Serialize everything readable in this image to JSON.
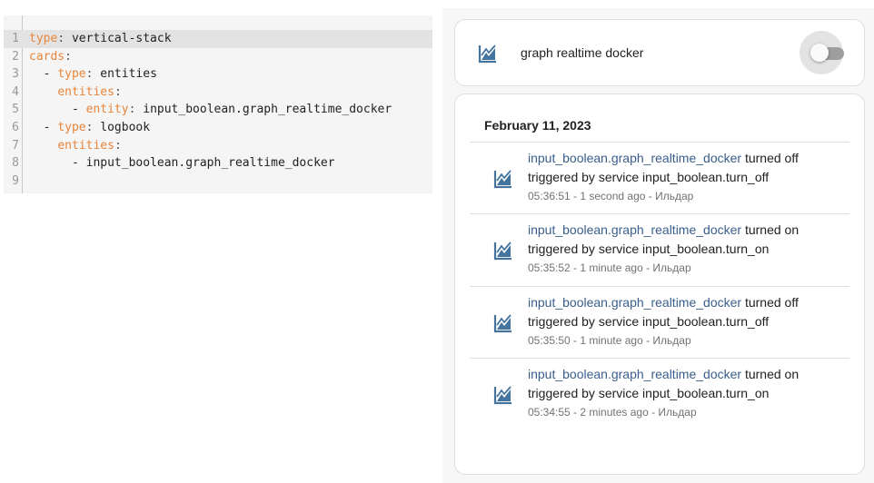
{
  "editor": {
    "lines": [
      {
        "num": "1",
        "indent": "",
        "dash": "",
        "key": "type",
        "sep": ": ",
        "value": "vertical-stack",
        "active": true
      },
      {
        "num": "2",
        "indent": "",
        "dash": "",
        "key": "cards",
        "sep": ":",
        "value": ""
      },
      {
        "num": "3",
        "indent": "  ",
        "dash": "- ",
        "key": "type",
        "sep": ": ",
        "value": "entities"
      },
      {
        "num": "4",
        "indent": "    ",
        "dash": "",
        "key": "entities",
        "sep": ":",
        "value": ""
      },
      {
        "num": "5",
        "indent": "      ",
        "dash": "- ",
        "key": "entity",
        "sep": ": ",
        "value": "input_boolean.graph_realtime_docker"
      },
      {
        "num": "6",
        "indent": "  ",
        "dash": "- ",
        "key": "type",
        "sep": ": ",
        "value": "logbook"
      },
      {
        "num": "7",
        "indent": "    ",
        "dash": "",
        "key": "entities",
        "sep": ":",
        "value": ""
      },
      {
        "num": "8",
        "indent": "      ",
        "dash": "- ",
        "key": "",
        "sep": "",
        "value": "input_boolean.graph_realtime_docker"
      },
      {
        "num": "9",
        "indent": "",
        "dash": "",
        "key": "",
        "sep": "",
        "value": ""
      }
    ]
  },
  "entity_card": {
    "icon": "chart-line-icon",
    "name": "graph realtime docker",
    "toggle_state": "off"
  },
  "logbook": {
    "date": "February 11, 2023",
    "entries": [
      {
        "entity": "input_boolean.graph_realtime_docker",
        "action": " turned off",
        "trigger": "triggered by service input_boolean.turn_off",
        "meta": "05:36:51 - 1 second ago - Ильдар"
      },
      {
        "entity": "input_boolean.graph_realtime_docker",
        "action": " turned on",
        "trigger": "triggered by service input_boolean.turn_on",
        "meta": "05:35:52 - 1 minute ago - Ильдар"
      },
      {
        "entity": "input_boolean.graph_realtime_docker",
        "action": " turned off",
        "trigger": "triggered by service input_boolean.turn_off",
        "meta": "05:35:50 - 1 minute ago - Ильдар"
      },
      {
        "entity": "input_boolean.graph_realtime_docker",
        "action": " turned on",
        "trigger": "triggered by service input_boolean.turn_on",
        "meta": "05:34:55 - 2 minutes ago - Ильдар"
      }
    ]
  },
  "colors": {
    "icon": "#44739e",
    "link": "#3a5e8c",
    "yaml_key": "#e8853a"
  }
}
